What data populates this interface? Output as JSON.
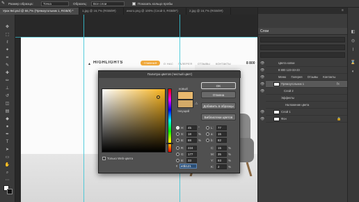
{
  "options_bar": {
    "sample_size_label": "Размер образца:",
    "sample_size_value": "Точка",
    "sample_label": "Образец:",
    "sample_value": "Все слои",
    "show_ring_label": "Показать кольцо пробы"
  },
  "tabs": [
    "Урок 9нl.psd @ 66,7% (Прямоугольник 1, RGB/8) *",
    "1.jpg @ 16,7% (RGB/8#)",
    "иного.png @ 100% (Слой 0, RGB/8*)",
    "2.jpg @ 16,7% (RGB/8#)"
  ],
  "canvas": {
    "site_logo": "HIGHLIGHTS",
    "nav_active": "ГЛАВНАЯ",
    "nav_items": [
      "О НАС",
      "ГАЛЕРЕЯ",
      "ОТЗЫВЫ",
      "КОНТАКТЫ"
    ],
    "phone": "8 800"
  },
  "picker": {
    "title": "Палитра цветов (чистый цвет)",
    "ok_label": "OK",
    "cancel_label": "Отмена",
    "add_swatch_label": "Добавить в образцы",
    "libraries_label": "Библиотеки цветов",
    "new_label": "новый",
    "current_label": "текущий",
    "web_only_label": "Только Web-цвета",
    "hsb": [
      {
        "label": "H:",
        "value": "45",
        "unit": "°"
      },
      {
        "label": "S:",
        "value": "18",
        "unit": "%"
      },
      {
        "label": "B:",
        "value": "88",
        "unit": "%"
      }
    ],
    "rgb": [
      {
        "label": "R:",
        "value": "224"
      },
      {
        "label": "G:",
        "value": "177"
      },
      {
        "label": "B:",
        "value": "33"
      }
    ],
    "lab": [
      {
        "label": "L:",
        "value": "77"
      },
      {
        "label": "a:",
        "value": "15"
      },
      {
        "label": "b:",
        "value": "82"
      }
    ],
    "cmyk": [
      {
        "label": "C:",
        "value": "15",
        "unit": "%"
      },
      {
        "label": "M:",
        "value": "35",
        "unit": "%"
      },
      {
        "label": "Y:",
        "value": "93",
        "unit": "%"
      },
      {
        "label": "K:",
        "value": "2",
        "unit": "%"
      }
    ],
    "hex_label": "#",
    "hex_value": "e0b121"
  },
  "layers": {
    "title": "Слои",
    "rows": [
      "Цвета копки",
      "8 800 123-33-23",
      "Меню",
      "Прямоугольник 1",
      "Слой 2",
      "Эффекты",
      "Наложение цвета",
      "Слой 1",
      "Фон"
    ],
    "menu_row": [
      "Меню",
      "Галерея",
      "Отзывы",
      "Контакты"
    ]
  }
}
